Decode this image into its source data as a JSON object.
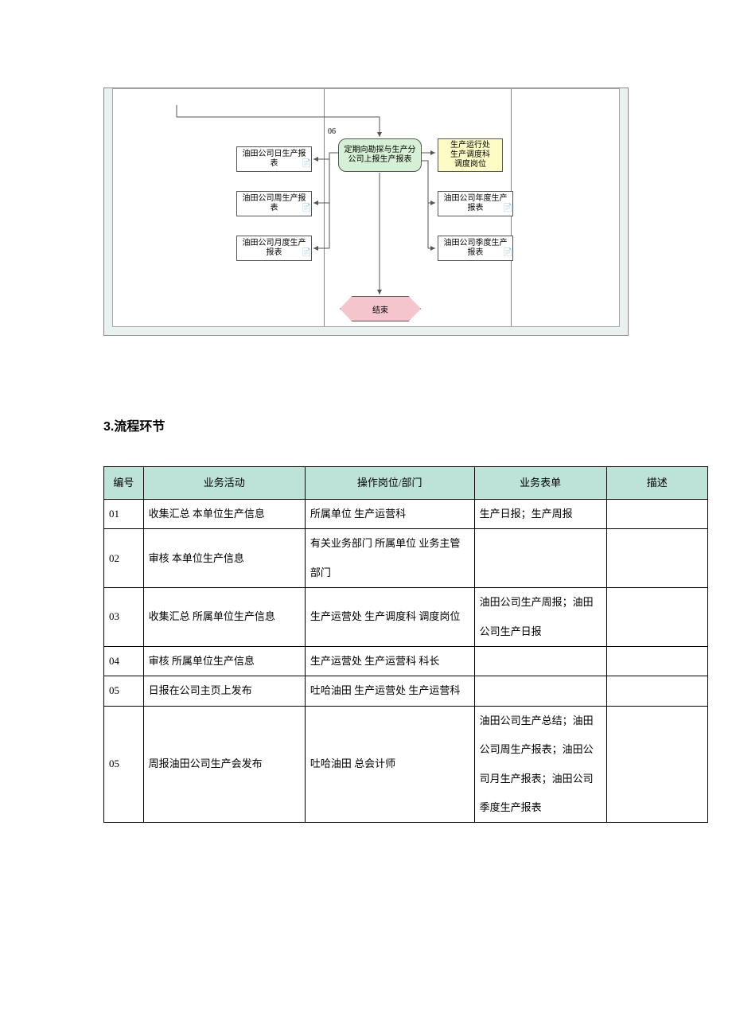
{
  "flowchart": {
    "step_label": "06",
    "left_boxes": [
      "油田公司日生产报表",
      "油田公司周生产报表",
      "油田公司月度生产报表"
    ],
    "center_green": "定期向勘探与生产分公司上报生产报表",
    "right_yellow": "生产运行处\n生产调度科\n调度岗位",
    "right_boxes": [
      "油田公司年度生产报表",
      "油田公司季度生产报表"
    ],
    "end": "结束"
  },
  "section_heading": "3.流程环节",
  "table": {
    "headers": {
      "num": "编号",
      "activity": "业务活动",
      "dept": "操作岗位/部门",
      "form": "业务表单",
      "desc": "描述"
    },
    "rows": [
      {
        "num": "01",
        "activity": "收集汇总 本单位生产信息",
        "dept": "所属单位 生产运营科",
        "form": "生产日报；生产周报",
        "desc": ""
      },
      {
        "num": "02",
        "activity": "审核 本单位生产信息",
        "dept": "有关业务部门 所属单位 业务主管部门",
        "form": "",
        "desc": ""
      },
      {
        "num": "03",
        "activity": "收集汇总 所属单位生产信息",
        "dept": "生产运营处 生产调度科 调度岗位",
        "form": "油田公司生产周报；油田公司生产日报",
        "desc": ""
      },
      {
        "num": "04",
        "activity": "审核 所属单位生产信息",
        "dept": "生产运营处 生产运营科 科长",
        "form": "",
        "desc": ""
      },
      {
        "num": "05",
        "activity": "日报在公司主页上发布",
        "dept": "吐哈油田 生产运营处 生产运营科",
        "form": "",
        "desc": ""
      },
      {
        "num": "05",
        "activity": "周报油田公司生产会发布",
        "dept": "吐哈油田 总会计师",
        "form": "油田公司生产总结；油田公司周生产报表；油田公司月生产报表；油田公司季度生产报表",
        "desc": ""
      }
    ]
  }
}
